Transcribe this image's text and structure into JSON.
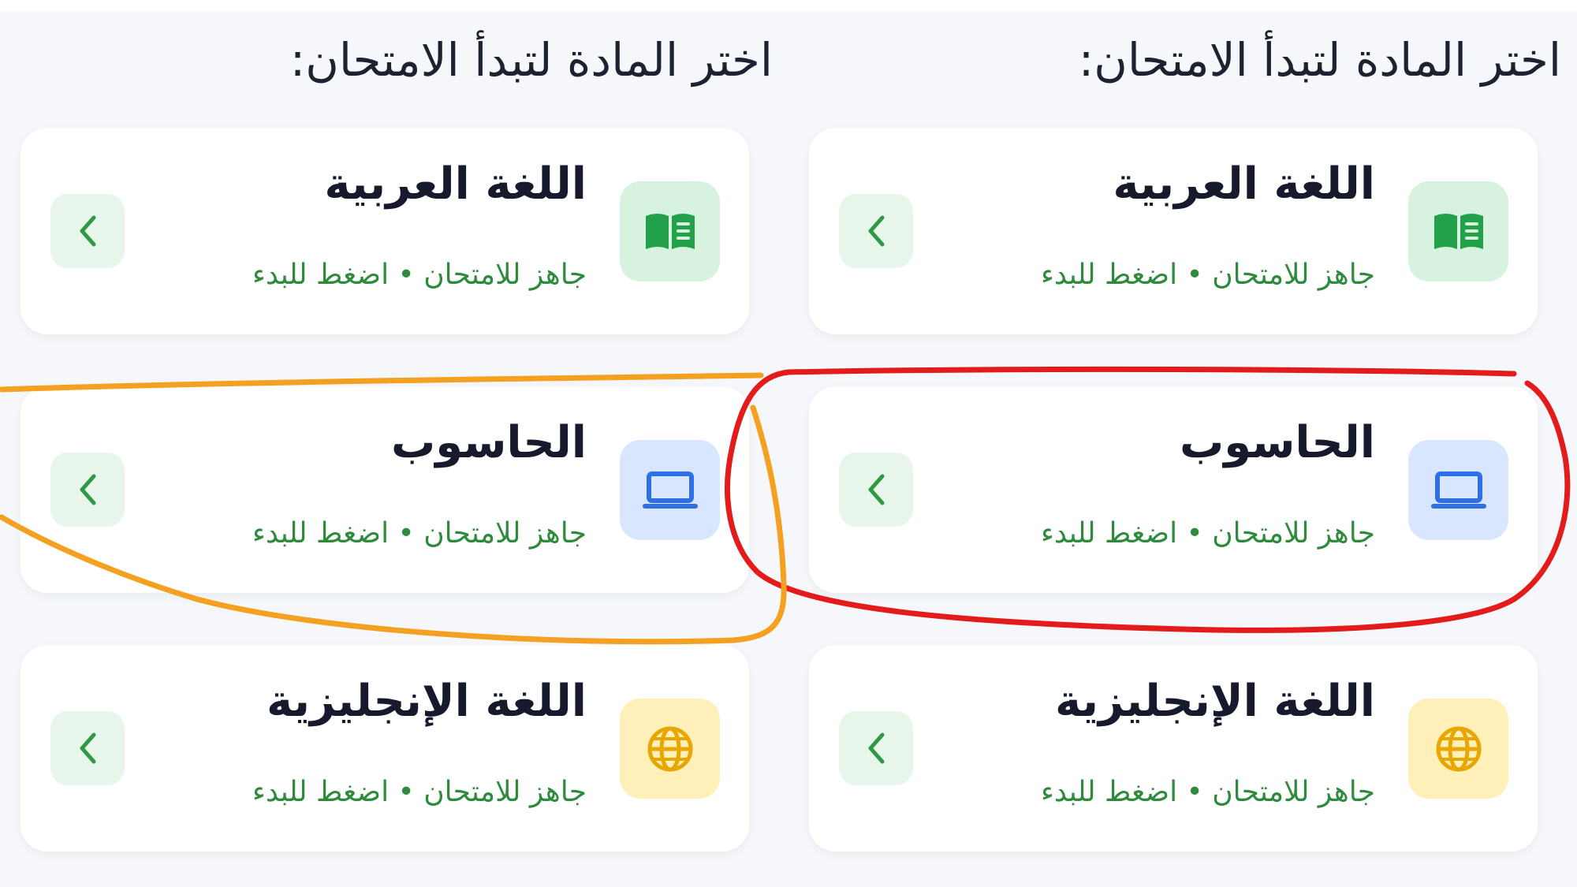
{
  "screens": [
    {
      "heading": "اختر المادة لتبدأ الامتحان:",
      "subjects": [
        {
          "title": "اللغة العربية",
          "subtitle": "جاهز للامتحان • اضغط للبدء",
          "icon": "book-icon",
          "tile_color": "#d7f3e0",
          "icon_color": "#22a04a"
        },
        {
          "title": "الحاسوب",
          "subtitle": "جاهز للامتحان • اضغط للبدء",
          "icon": "laptop-icon",
          "tile_color": "#d9e6ff",
          "icon_color": "#2f6fe4"
        },
        {
          "title": "اللغة الإنجليزية",
          "subtitle": "جاهز للامتحان • اضغط للبدء",
          "icon": "globe-icon",
          "tile_color": "#ffefb8",
          "icon_color": "#e8a700"
        }
      ]
    },
    {
      "heading": "اختر المادة لتبدأ الامتحان:",
      "subjects": [
        {
          "title": "اللغة العربية",
          "subtitle": "جاهز للامتحان • اضغط للبدء",
          "icon": "book-icon",
          "tile_color": "#d7f3e0",
          "icon_color": "#22a04a"
        },
        {
          "title": "الحاسوب",
          "subtitle": "جاهز للامتحان • اضغط للبدء",
          "icon": "laptop-icon",
          "tile_color": "#d9e6ff",
          "icon_color": "#2f6fe4"
        },
        {
          "title": "اللغة الإنجليزية",
          "subtitle": "جاهز للامتحان • اضغط للبدء",
          "icon": "globe-icon",
          "tile_color": "#ffefb8",
          "icon_color": "#e8a700"
        }
      ]
    }
  ],
  "colors": {
    "page_background": "#f5f7fa",
    "card_background": "#ffffff",
    "title_text": "#161a2c",
    "subtitle_text": "#2f8a3e",
    "chevron": "#2f9a45",
    "chevron_button_bg": "#e8f5ea",
    "annotation_red": "#e31b1b",
    "annotation_orange": "#f4a020"
  },
  "annotations": [
    {
      "shape": "freehand-loop",
      "color": "red",
      "marks": "right-screen-computer-card"
    },
    {
      "shape": "freehand-loop",
      "color": "orange",
      "marks": "left-screen-computer-card"
    }
  ]
}
